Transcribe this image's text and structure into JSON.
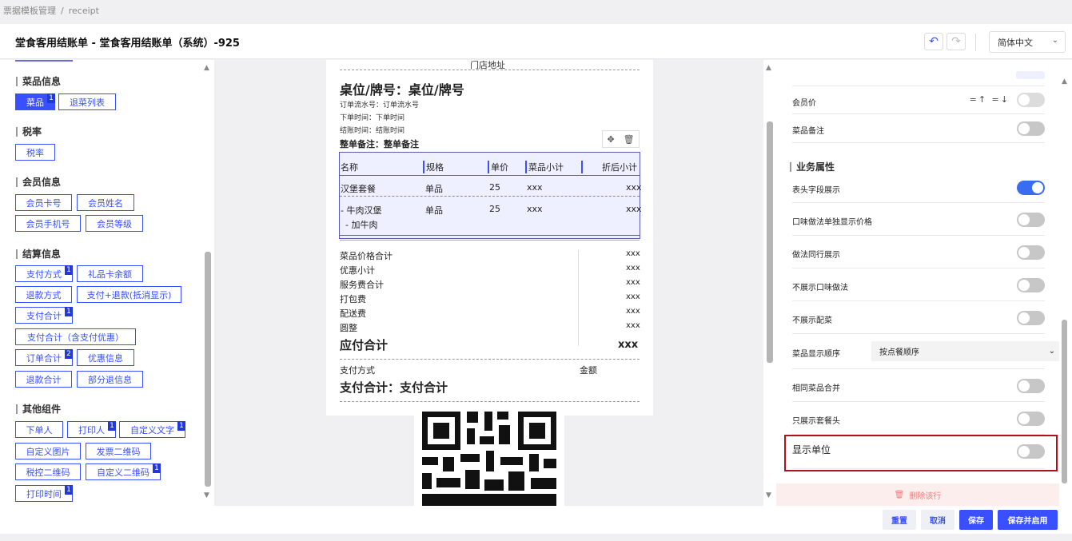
{
  "breadcrumb": {
    "root": "票据模板管理",
    "sep": "/",
    "current": "receipt"
  },
  "header": {
    "title": "堂食客用结账单 - 堂食客用结账单（系统）-925",
    "undo_glyph": "↶",
    "redo_glyph": "↷",
    "language": "简体中文"
  },
  "left": {
    "sections": [
      {
        "title": "菜品信息"
      },
      {
        "title": "税率"
      },
      {
        "title": "会员信息"
      },
      {
        "title": "结算信息"
      },
      {
        "title": "其他组件"
      }
    ],
    "chips": {
      "dish": "菜品",
      "dish_badge": "1",
      "return_list": "退菜列表",
      "tax": "税率",
      "member_card": "会员卡号",
      "member_name": "会员姓名",
      "member_phone": "会员手机号",
      "member_level": "会员等级",
      "pay_method": "支付方式",
      "pay_method_badge": "1",
      "gift_card": "礼品卡余额",
      "refund_method": "退款方式",
      "pay_refund": "支付+退款(抵消显示)",
      "pay_total": "支付合计",
      "pay_total_badge": "1",
      "pay_total_discount": "支付合计（含支付优惠）",
      "order_total": "订单合计",
      "order_total_badge": "2",
      "discount_info": "优惠信息",
      "refund_total": "退款合计",
      "partial_refund": "部分退信息",
      "orderer": "下单人",
      "printer": "打印人",
      "printer_badge": "1",
      "custom_text": "自定义文字",
      "custom_text_badge": "1",
      "custom_image": "自定义图片",
      "invoice_qr": "发票二维码",
      "tax_qr": "税控二维码",
      "custom_qr": "自定义二维码",
      "custom_qr_badge": "1",
      "print_time": "打印时间",
      "print_time_badge": "1"
    }
  },
  "receipt": {
    "store_address": "门店地址",
    "table_title": "桌位/牌号：桌位/牌号",
    "order_no": "订单流水号：订单流水号",
    "order_time": "下单时间：下单时间",
    "checkout_time": "结账时间：结账时间",
    "order_note": "整单备注：整单备注",
    "columns": [
      "名称",
      "规格",
      "单价",
      "菜品小计",
      "折后小计"
    ],
    "rows": [
      {
        "name": "汉堡套餐",
        "spec": "单品",
        "price": "25",
        "subtotal": "xxx",
        "after": "xxx"
      },
      {
        "name": "- 牛肉汉堡",
        "spec": "单品",
        "price": "25",
        "subtotal": "xxx",
        "after": "xxx",
        "sub": "- 加牛肉"
      }
    ],
    "summary": [
      {
        "label": "菜品价格合计",
        "value": "xxx"
      },
      {
        "label": "优惠小计",
        "value": "xxx"
      },
      {
        "label": "服务费合计",
        "value": "xxx"
      },
      {
        "label": "打包费",
        "value": "xxx"
      },
      {
        "label": "配送费",
        "value": "xxx"
      },
      {
        "label": "圆整",
        "value": "xxx"
      }
    ],
    "due_label": "应付合计",
    "due_value": "xxx",
    "pay_method_label": "支付方式",
    "amount_label": "金额",
    "pay_total_line": "支付合计：支付合计"
  },
  "right": {
    "member_price": "会员价",
    "dish_note": "菜品备注",
    "business_title": "业务属性",
    "header_field": "表头字段展示",
    "taste_price": "口味做法单独显示价格",
    "method_same_line": "做法同行展示",
    "hide_taste": "不展示口味做法",
    "hide_side": "不展示配菜",
    "dish_order_label": "菜品显示顺序",
    "dish_order_value": "按点餐顺序",
    "merge_same": "相同菜品合并",
    "only_set_head": "只展示套餐头",
    "show_unit": "显示单位",
    "delete_row": "删除该行",
    "toggle_on_color": "#3a6cf0"
  },
  "footer": {
    "reset": "重置",
    "cancel": "取消",
    "save": "保存",
    "save_enable": "保存并启用"
  }
}
